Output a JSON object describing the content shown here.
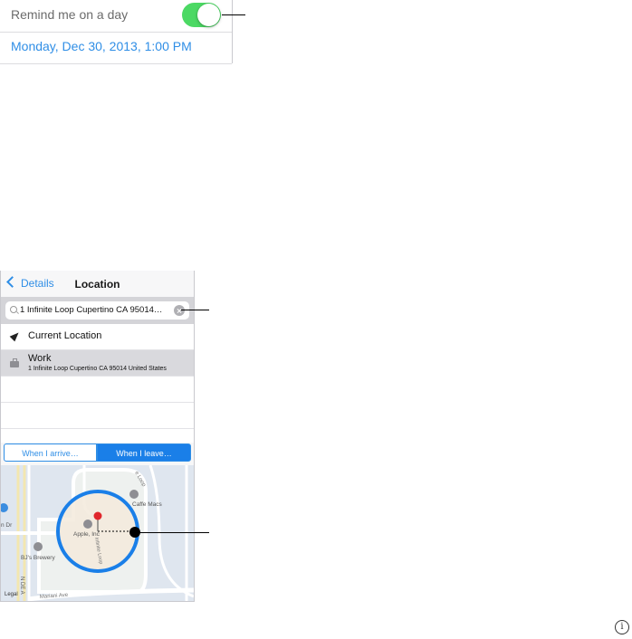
{
  "reminder": {
    "label": "Remind me on a day",
    "toggle_on": true,
    "date": "Monday, Dec 30, 2013, 1:00 PM"
  },
  "nav": {
    "back_label": "Details",
    "title": "Location"
  },
  "search": {
    "value": "1 Infinite Loop Cupertino CA 95014…"
  },
  "locations": [
    {
      "icon": "location-arrow-icon",
      "title": "Current Location",
      "subtitle": ""
    },
    {
      "icon": "briefcase-icon",
      "title": "Work",
      "subtitle": "1 Infinite Loop Cupertino CA 95014 United States"
    }
  ],
  "segments": {
    "arrive": "When I arrive…",
    "leave": "When I leave…",
    "selected": "leave"
  },
  "map": {
    "labels": {
      "apple": "Apple, Inc",
      "caffe": "Caffe Macs",
      "brewery": "BJ's Brewery",
      "infinite_loop": "Infinite Loop",
      "loop_top": "e Loop",
      "mariani": "Mariani Ave",
      "dr": "n Dr",
      "legal": "Legal",
      "nde": "N DE A"
    }
  },
  "colors": {
    "accent": "#2f8ee6",
    "toggle_on": "#4cd964",
    "geofence": "#1a7fe8",
    "pin": "#e0262b"
  }
}
